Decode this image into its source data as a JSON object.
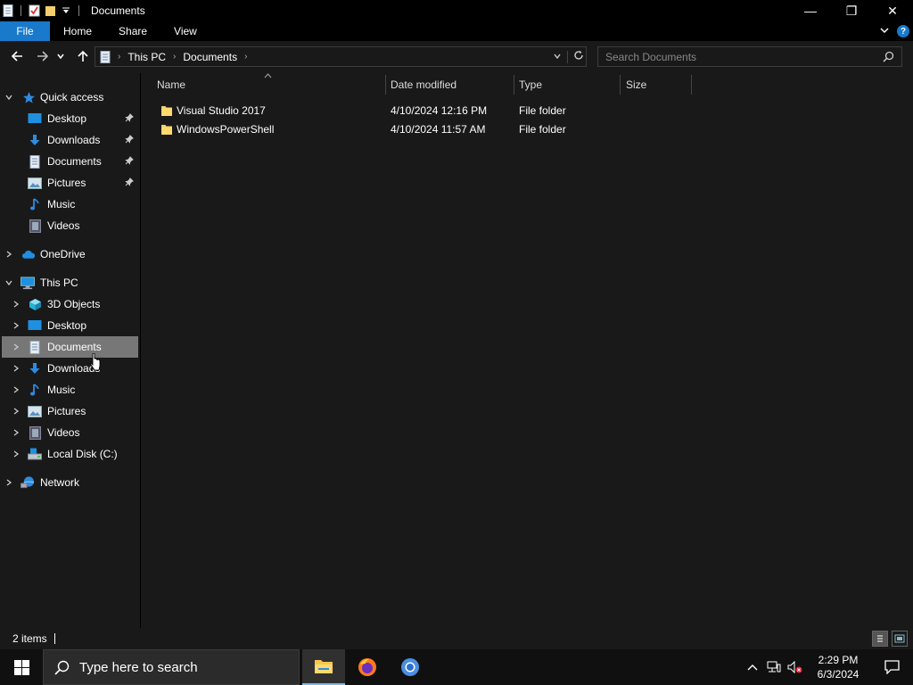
{
  "window": {
    "title": "Documents",
    "minimize_glyph": "—",
    "restore_glyph": "❐",
    "close_glyph": "✕"
  },
  "ribbon": {
    "tabs": [
      "File",
      "Home",
      "Share",
      "View"
    ]
  },
  "address": {
    "crumbs": [
      "This PC",
      "Documents"
    ],
    "search_placeholder": "Search Documents"
  },
  "nav": {
    "quick_access": "Quick access",
    "quick_items": [
      "Desktop",
      "Downloads",
      "Documents",
      "Pictures",
      "Music",
      "Videos"
    ],
    "onedrive": "OneDrive",
    "this_pc": "This PC",
    "pc_items": [
      "3D Objects",
      "Desktop",
      "Documents",
      "Downloads",
      "Music",
      "Pictures",
      "Videos",
      "Local Disk (C:)"
    ],
    "network": "Network",
    "selected": "Documents"
  },
  "columns": {
    "name": "Name",
    "date": "Date modified",
    "type": "Type",
    "size": "Size"
  },
  "files": [
    {
      "name": "Visual Studio 2017",
      "date": "4/10/2024 12:16 PM",
      "type": "File folder",
      "size": ""
    },
    {
      "name": "WindowsPowerShell",
      "date": "4/10/2024 11:57 AM",
      "type": "File folder",
      "size": ""
    }
  ],
  "status": {
    "item_count": "2 items"
  },
  "taskbar": {
    "search_placeholder": "Type here to search",
    "time": "2:29 PM",
    "date": "6/3/2024"
  },
  "colors": {
    "accent": "#1979ca",
    "pane_bg": "#191919",
    "folder": "#f5cf6b"
  }
}
